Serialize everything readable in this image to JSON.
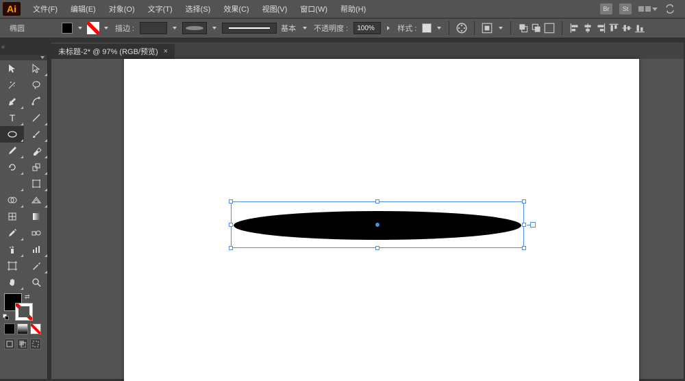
{
  "app": {
    "logo": "Ai"
  },
  "menubar": {
    "items": [
      "文件(F)",
      "编辑(E)",
      "对象(O)",
      "文字(T)",
      "选择(S)",
      "效果(C)",
      "视图(V)",
      "窗口(W)",
      "帮助(H)"
    ],
    "right": {
      "br": "Br",
      "st": "St"
    }
  },
  "options": {
    "tool_name": "椭圆",
    "stroke_label": "描边 :",
    "stroke_val": "",
    "style_label": "基本",
    "opacity_label": "不透明度 :",
    "opacity_val": "100%",
    "preset_label": "样式 :"
  },
  "doc_tab": {
    "title": "未标题-2* @ 97% (RGB/预览)",
    "close": "×"
  },
  "panel_min": "«"
}
